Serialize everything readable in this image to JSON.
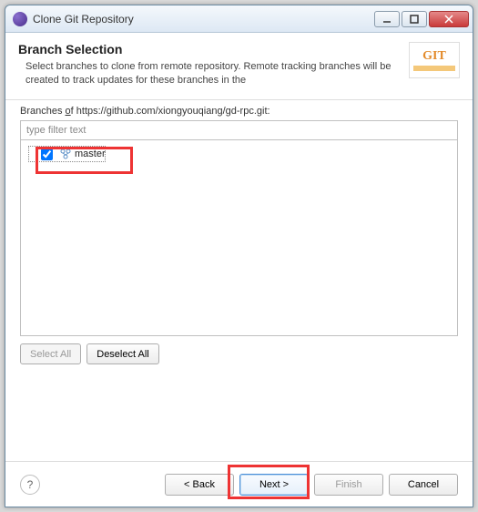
{
  "window": {
    "title": "Clone Git Repository"
  },
  "header": {
    "title": "Branch Selection",
    "description": "Select branches to clone from remote repository. Remote tracking branches will be created to track updates for these branches in the"
  },
  "branches": {
    "label_prefix": "Branches ",
    "label_of": "o",
    "label_suffix": "f https://github.com/xiongyouqiang/gd-rpc.git:",
    "filter_placeholder": "type filter text",
    "items": [
      {
        "name": "master",
        "checked": true
      }
    ]
  },
  "select_buttons": {
    "select_all": "Select All",
    "deselect_all": "Deselect All"
  },
  "footer": {
    "back": "< Back",
    "next": "Next >",
    "finish": "Finish",
    "cancel": "Cancel"
  }
}
